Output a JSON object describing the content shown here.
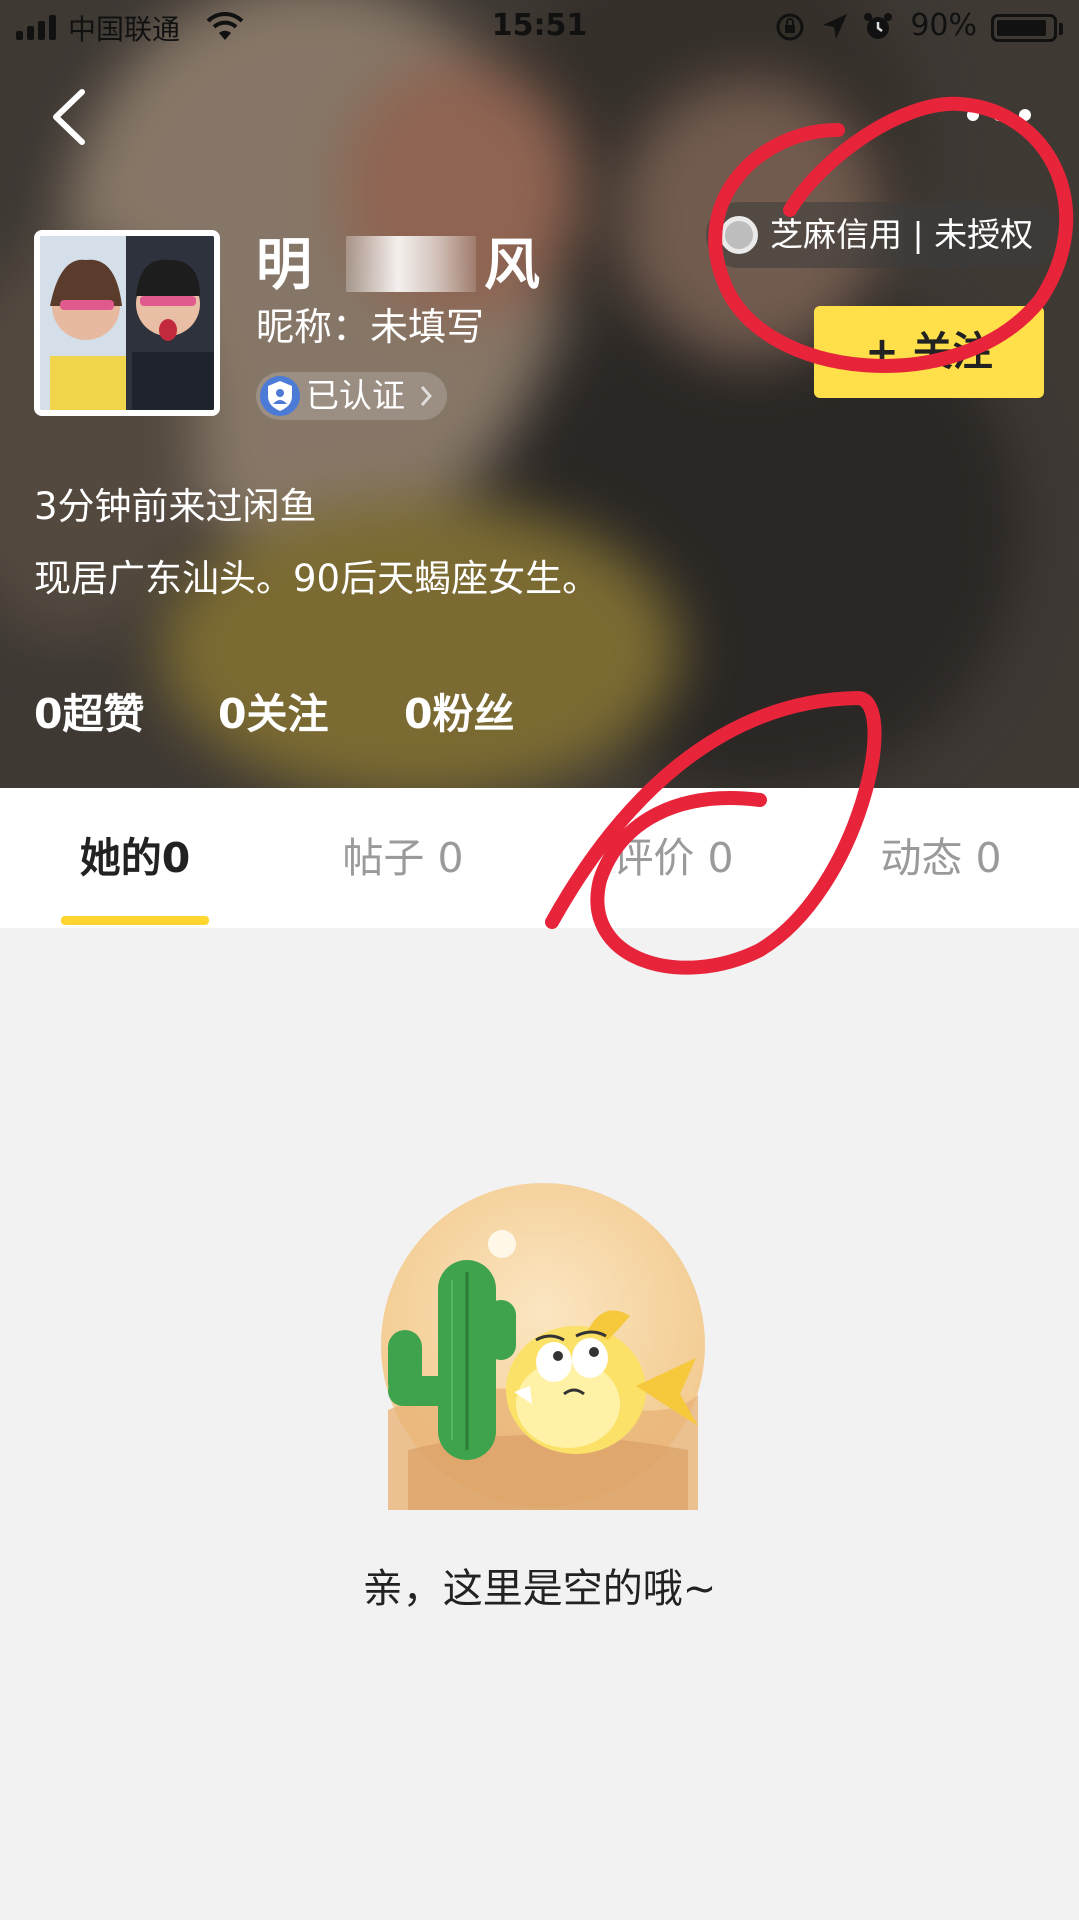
{
  "status_bar": {
    "carrier": "中国联通",
    "time": "15:51",
    "battery": "90%",
    "battery_level": 0.9
  },
  "header": {
    "back_icon": "chevron-left-icon",
    "more_icon": "more-dots-icon"
  },
  "profile": {
    "name_prefix": "明",
    "name_suffix": "风",
    "nickname_label": "昵称：",
    "nickname_value": "未填写",
    "certified_label": "已认证",
    "zhima_label": "芝麻信用 | 未授权",
    "follow_label": "+ 关注",
    "last_seen": "3分钟前来过闲鱼",
    "bio": "现居广东汕头。90后天蝎座女生。"
  },
  "stats": [
    {
      "label": "0超赞"
    },
    {
      "label": "0关注"
    },
    {
      "label": "0粉丝"
    }
  ],
  "tabs": [
    {
      "label": "她的0",
      "active": true
    },
    {
      "label": "帖子 0",
      "active": false
    },
    {
      "label": "评价 0",
      "active": false
    },
    {
      "label": "动态 0",
      "active": false
    }
  ],
  "empty_state": {
    "message": "亲，这里是空的哦~",
    "illustration": "cactus-fish-illustration"
  },
  "colors": {
    "accent": "#ffe04a",
    "tab_indicator": "#ffd52e",
    "annotation": "#e8243a"
  }
}
